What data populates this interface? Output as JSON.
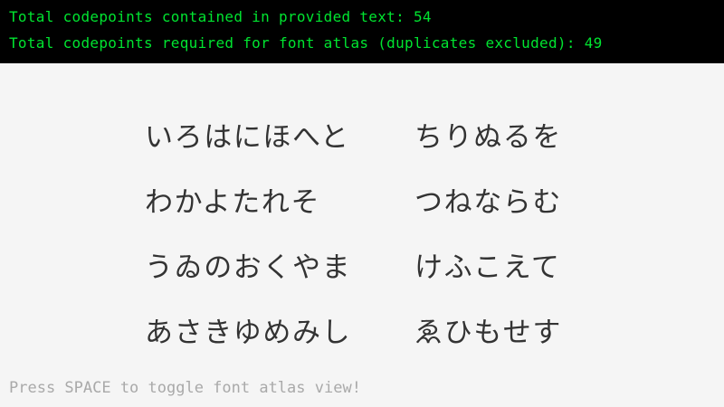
{
  "info": {
    "total_codepoints": "Total codepoints contained in provided text: 54",
    "required_codepoints": "Total codepoints required for font atlas (duplicates excluded): 49"
  },
  "poem": {
    "lines": [
      {
        "first": "いろはにほへと",
        "second": "ちりぬるを"
      },
      {
        "first": "わかよたれそ",
        "second": "つねならむ"
      },
      {
        "first": "うゐのおくやま",
        "second": "けふこえて"
      },
      {
        "first": "あさきゆめみし",
        "second": "ゑひもせす"
      }
    ]
  },
  "footer": {
    "hint": "Press SPACE to toggle font atlas view!"
  },
  "colors": {
    "background": "#f5f5f5",
    "info_bar": "#000000",
    "info_text": "#00e430",
    "poem_text": "#333333",
    "hint_text": "#a9a9a9"
  }
}
